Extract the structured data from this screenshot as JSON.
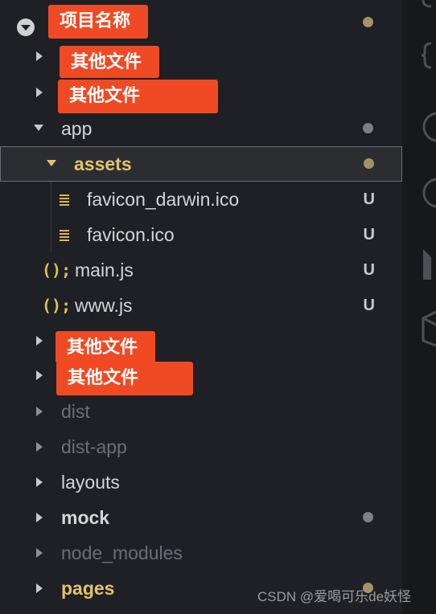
{
  "explorer": {
    "root": {
      "label": "项目名称"
    },
    "tags": {
      "t1": "其他文件",
      "t2": "其他文件",
      "t3": "其他文件",
      "t4": "其他文件"
    },
    "items": {
      "app": "app",
      "assets": "assets",
      "favicon_darwin": "favicon_darwin.ico",
      "favicon": "favicon.ico",
      "main": "main.js",
      "www": "www.js",
      "dist": "dist",
      "dist_app": "dist-app",
      "layouts": "layouts",
      "mock": "mock",
      "node_modules": "node_modules",
      "pages": "pages"
    },
    "status_untracked": "U",
    "js_icon": "();"
  },
  "watermark": "CSDN @爱喝可乐de妖怪",
  "colors": {
    "accent": "#f04a24",
    "modified_dot": "#a39265",
    "folder_highlight": "#e2c26b"
  }
}
